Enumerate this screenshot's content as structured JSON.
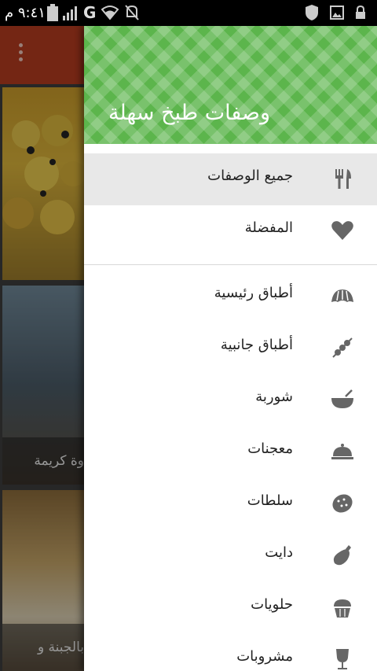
{
  "status_bar": {
    "time": "٩:٤١ م",
    "network": "G"
  },
  "drawer": {
    "title": "وصفات طبخ سهلة",
    "primary_items": [
      {
        "label": "جميع الوصفات",
        "icon": "fork-knife-icon",
        "active": true
      },
      {
        "label": "المفضلة",
        "icon": "heart-icon",
        "active": false
      }
    ],
    "category_items": [
      {
        "label": "أطباق رئيسية",
        "icon": "croissant-icon"
      },
      {
        "label": "أطباق جانبية",
        "icon": "kebab-icon"
      },
      {
        "label": "شوربة",
        "icon": "soup-bowl-icon"
      },
      {
        "label": "معجنات",
        "icon": "cloche-icon"
      },
      {
        "label": "سلطات",
        "icon": "potato-icon"
      },
      {
        "label": "دايت",
        "icon": "eggplant-icon"
      },
      {
        "label": "حلويات",
        "icon": "cupcake-icon"
      },
      {
        "label": "مشروبات",
        "icon": "wine-glass-icon"
      }
    ]
  },
  "background": {
    "card2_text": "وة كريمة",
    "card3_text": "بالجبنة و"
  },
  "colors": {
    "toolbar": "#b33b1f",
    "drawer_header": "#5cb54c",
    "icon": "#666666"
  }
}
